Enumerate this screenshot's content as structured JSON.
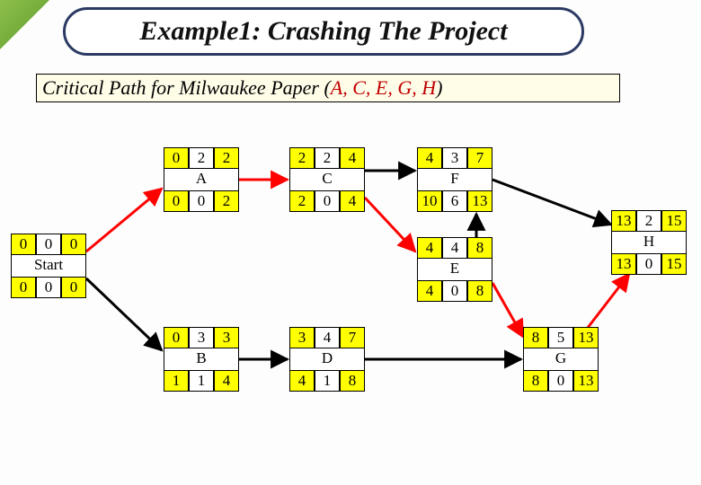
{
  "title": "Example1: Crashing The Project",
  "subtitle_prefix": "Critical Path for Milwaukee Paper (",
  "subtitle_cp": "A, C, E, G, H",
  "subtitle_suffix": ")",
  "nodes": {
    "Start": {
      "label": "Start",
      "es": "0",
      "dur": "0",
      "ef": "0",
      "ls": "0",
      "slack": "0",
      "lf": "0"
    },
    "A": {
      "label": "A",
      "es": "0",
      "dur": "2",
      "ef": "2",
      "ls": "0",
      "slack": "0",
      "lf": "2"
    },
    "B": {
      "label": "B",
      "es": "0",
      "dur": "3",
      "ef": "3",
      "ls": "1",
      "slack": "1",
      "lf": "4"
    },
    "C": {
      "label": "C",
      "es": "2",
      "dur": "2",
      "ef": "4",
      "ls": "2",
      "slack": "0",
      "lf": "4"
    },
    "D": {
      "label": "D",
      "es": "3",
      "dur": "4",
      "ef": "7",
      "ls": "4",
      "slack": "1",
      "lf": "8"
    },
    "E": {
      "label": "E",
      "es": "4",
      "dur": "4",
      "ef": "8",
      "ls": "4",
      "slack": "0",
      "lf": "8"
    },
    "F": {
      "label": "F",
      "es": "4",
      "dur": "3",
      "ef": "7",
      "ls": "10",
      "slack": "6",
      "lf": "13"
    },
    "G": {
      "label": "G",
      "es": "8",
      "dur": "5",
      "ef": "13",
      "ls": "8",
      "slack": "0",
      "lf": "13"
    },
    "H": {
      "label": "H",
      "es": "13",
      "dur": "2",
      "ef": "15",
      "ls": "13",
      "slack": "0",
      "lf": "15"
    }
  }
}
